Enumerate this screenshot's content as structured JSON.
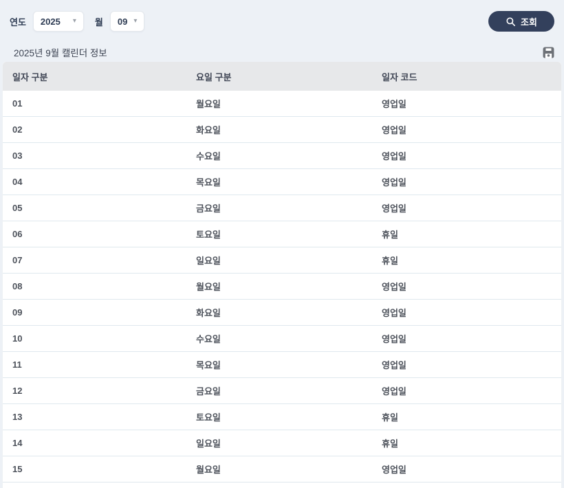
{
  "toolbar": {
    "year_label": "연도",
    "year_value": "2025",
    "month_label": "월",
    "month_value": "09",
    "search_button_label": "조회",
    "accent_color": "#33405c"
  },
  "panel": {
    "title": "2025년 9월 캘린더 정보",
    "save_icon": "floppy-disk-icon",
    "save_icon_color": "#6d7177"
  },
  "table": {
    "columns": [
      "일자 구분",
      "요일 구분",
      "일자 코드"
    ],
    "rows": [
      [
        "01",
        "월요일",
        "영업일"
      ],
      [
        "02",
        "화요일",
        "영업일"
      ],
      [
        "03",
        "수요일",
        "영업일"
      ],
      [
        "04",
        "목요일",
        "영업일"
      ],
      [
        "05",
        "금요일",
        "영업일"
      ],
      [
        "06",
        "토요일",
        "휴일"
      ],
      [
        "07",
        "일요일",
        "휴일"
      ],
      [
        "08",
        "월요일",
        "영업일"
      ],
      [
        "09",
        "화요일",
        "영업일"
      ],
      [
        "10",
        "수요일",
        "영업일"
      ],
      [
        "11",
        "목요일",
        "영업일"
      ],
      [
        "12",
        "금요일",
        "영업일"
      ],
      [
        "13",
        "토요일",
        "휴일"
      ],
      [
        "14",
        "일요일",
        "휴일"
      ],
      [
        "15",
        "월요일",
        "영업일"
      ]
    ]
  }
}
